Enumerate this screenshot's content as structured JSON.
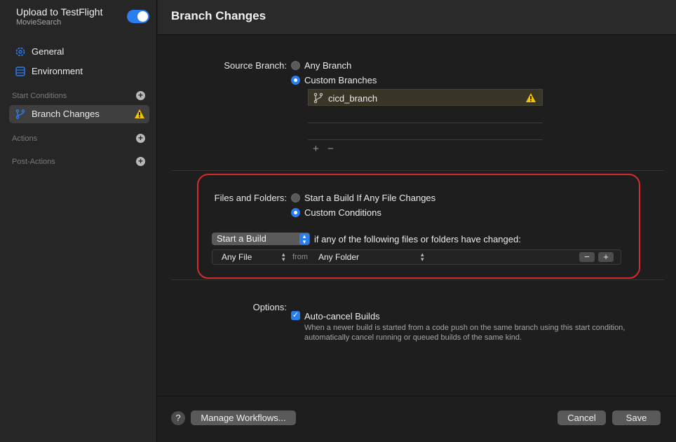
{
  "sidebar": {
    "workflow_title": "Upload to TestFlight",
    "workflow_subtitle": "MovieSearch",
    "enabled": true,
    "items": [
      {
        "label": "General",
        "icon": "gear-icon"
      },
      {
        "label": "Environment",
        "icon": "database-icon"
      }
    ],
    "sections": {
      "start_conditions": "Start Conditions",
      "actions": "Actions",
      "post_actions": "Post-Actions"
    },
    "selected_item": {
      "label": "Branch Changes",
      "icon": "branch-icon",
      "warning": true
    }
  },
  "main": {
    "title": "Branch Changes",
    "source_branch": {
      "label": "Source Branch:",
      "options": [
        "Any Branch",
        "Custom Branches"
      ],
      "selected": "Custom Branches",
      "branches": [
        {
          "name": "cicd_branch",
          "warning": true
        }
      ],
      "add": "+",
      "remove": "−"
    },
    "files_and_folders": {
      "label": "Files and Folders:",
      "options": [
        "Start a Build If Any File Changes",
        "Custom Conditions"
      ],
      "selected": "Custom Conditions",
      "action_popup": "Start a Build",
      "condition_text": "if any of the following files or folders have changed:",
      "rule": {
        "file": "Any File",
        "from": "from",
        "folder": "Any Folder",
        "remove": "−",
        "add": "+"
      }
    },
    "options": {
      "label": "Options:",
      "auto_cancel_label": "Auto-cancel Builds",
      "auto_cancel_checked": true,
      "description": "When a newer build is started from a code push on the same branch using this start condition, automatically cancel running or queued builds of the same kind."
    }
  },
  "footer": {
    "help": "?",
    "manage": "Manage Workflows...",
    "cancel": "Cancel",
    "save": "Save"
  },
  "colors": {
    "accent": "#2a7ef0",
    "warning": "#f5c400",
    "highlight": "#d62b2b"
  }
}
